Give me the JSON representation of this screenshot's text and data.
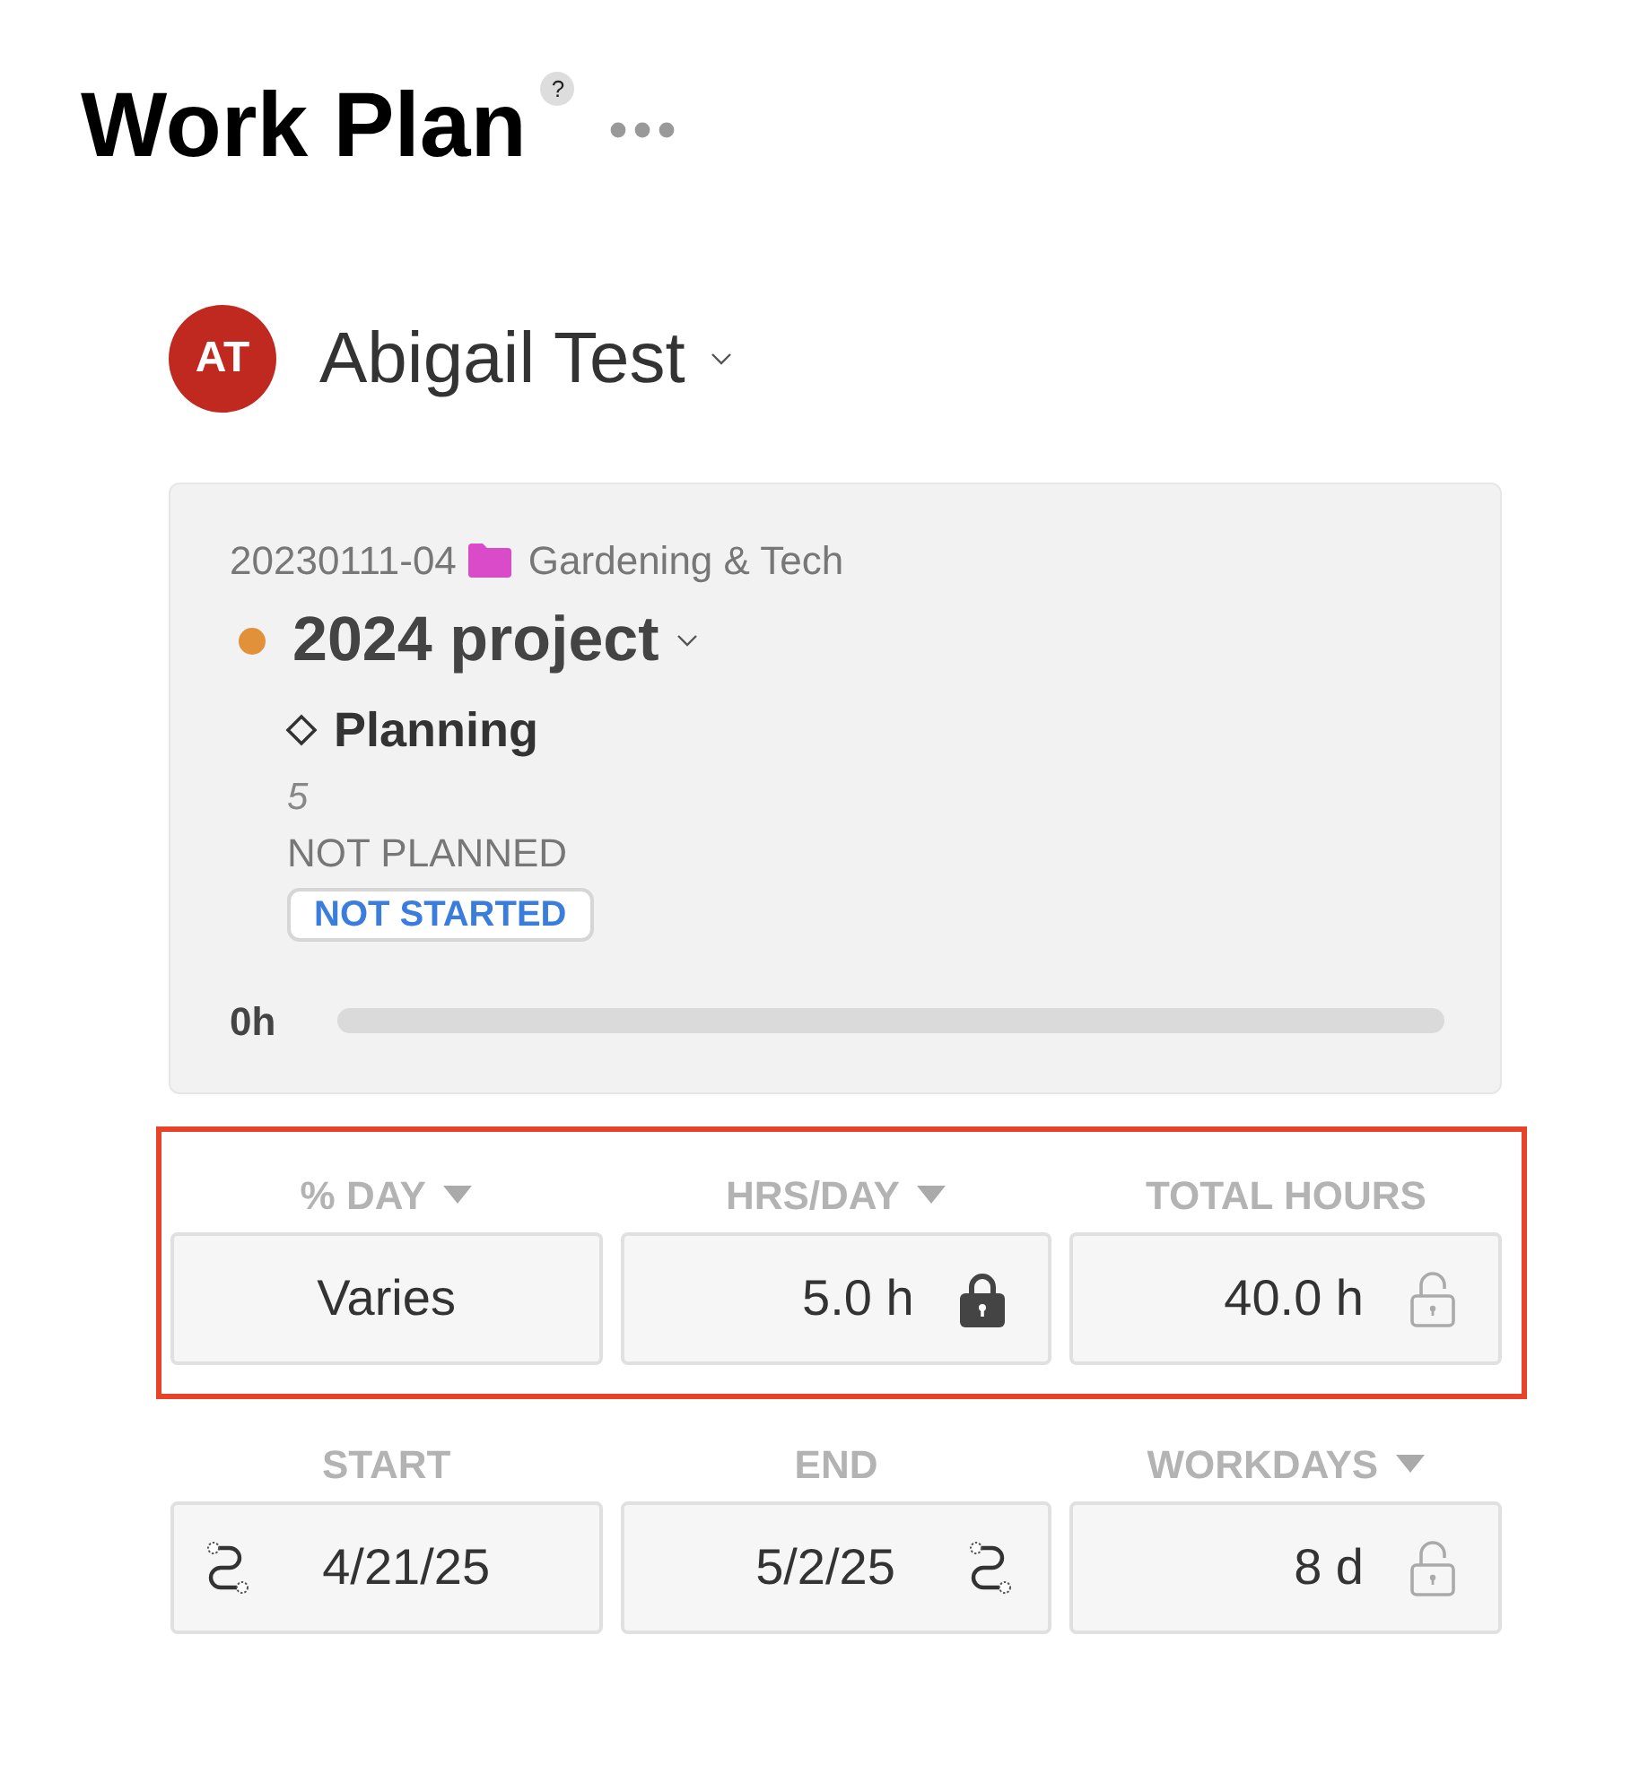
{
  "header": {
    "title": "Work Plan",
    "help": "?"
  },
  "member": {
    "initials": "AT",
    "name": "Abigail Test"
  },
  "project_card": {
    "project_number": "20230111-04",
    "folder_name": "Gardening & Tech",
    "project_name": "2024 project",
    "phase": "Planning",
    "count": "5",
    "plan_status": "NOT PLANNED",
    "status_badge": "NOT STARTED",
    "hours": "0h",
    "level": 0
  },
  "sections": [
    {
      "highlighted": true,
      "fields": [
        {
          "label": "% DAY",
          "dropdown": true,
          "kind": "select",
          "value": "Varies"
        },
        {
          "label": "HRS/DAY",
          "dropdown": true,
          "kind": "lockable",
          "value": "5.0 h",
          "locked": true
        },
        {
          "label": "TOTAL HOURS",
          "dropdown": false,
          "kind": "lockable",
          "value": "40.0 h",
          "locked": false
        }
      ]
    },
    {
      "highlighted": false,
      "fields": [
        {
          "label": "START",
          "dropdown": false,
          "kind": "start",
          "value": "4/21/25"
        },
        {
          "label": "END",
          "dropdown": false,
          "kind": "end",
          "value": "5/2/25"
        },
        {
          "label": "WORKDAYS",
          "dropdown": true,
          "kind": "lockable",
          "value": "8 d",
          "locked": false
        }
      ]
    }
  ]
}
